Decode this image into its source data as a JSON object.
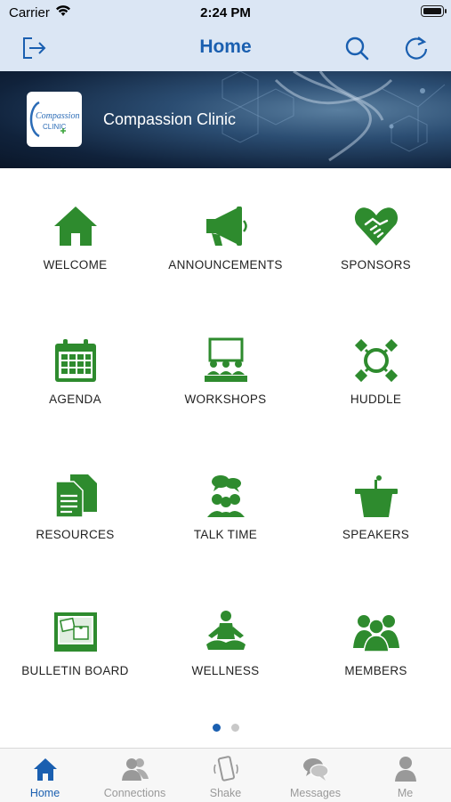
{
  "status_bar": {
    "carrier": "Carrier",
    "time": "2:24 PM"
  },
  "nav": {
    "title": "Home",
    "left_icon": "logout-icon",
    "right_icons": [
      "search-icon",
      "refresh-icon"
    ]
  },
  "banner": {
    "org_name": "Compassion Clinic",
    "logo_text_line1": "Compassion",
    "logo_text_line2": "CLINIC"
  },
  "grid": [
    {
      "label": "WELCOME",
      "icon": "home-icon"
    },
    {
      "label": "ANNOUNCEMENTS",
      "icon": "megaphone-icon"
    },
    {
      "label": "SPONSORS",
      "icon": "handshake-heart-icon"
    },
    {
      "label": "AGENDA",
      "icon": "calendar-icon"
    },
    {
      "label": "WORKSHOPS",
      "icon": "presentation-audience-icon"
    },
    {
      "label": "HUDDLE",
      "icon": "huddle-icon"
    },
    {
      "label": "RESOURCES",
      "icon": "documents-icon"
    },
    {
      "label": "TALK TIME",
      "icon": "talk-people-icon"
    },
    {
      "label": "SPEAKERS",
      "icon": "podium-icon"
    },
    {
      "label": "BULLETIN BOARD",
      "icon": "bulletin-board-icon"
    },
    {
      "label": "WELLNESS",
      "icon": "meditation-icon"
    },
    {
      "label": "MEMBERS",
      "icon": "group-icon"
    }
  ],
  "pager": {
    "current": 1,
    "total": 2
  },
  "tabs": [
    {
      "label": "Home",
      "icon": "home-icon",
      "active": true
    },
    {
      "label": "Connections",
      "icon": "people-icon",
      "active": false
    },
    {
      "label": "Shake",
      "icon": "phone-shake-icon",
      "active": false
    },
    {
      "label": "Messages",
      "icon": "chat-bubbles-icon",
      "active": false
    },
    {
      "label": "Me",
      "icon": "person-icon",
      "active": false
    }
  ],
  "colors": {
    "accent": "#1a5fb0",
    "icon_green": "#2e8b2e",
    "tab_inactive": "#999999",
    "nav_bg": "#dbe6f4"
  }
}
